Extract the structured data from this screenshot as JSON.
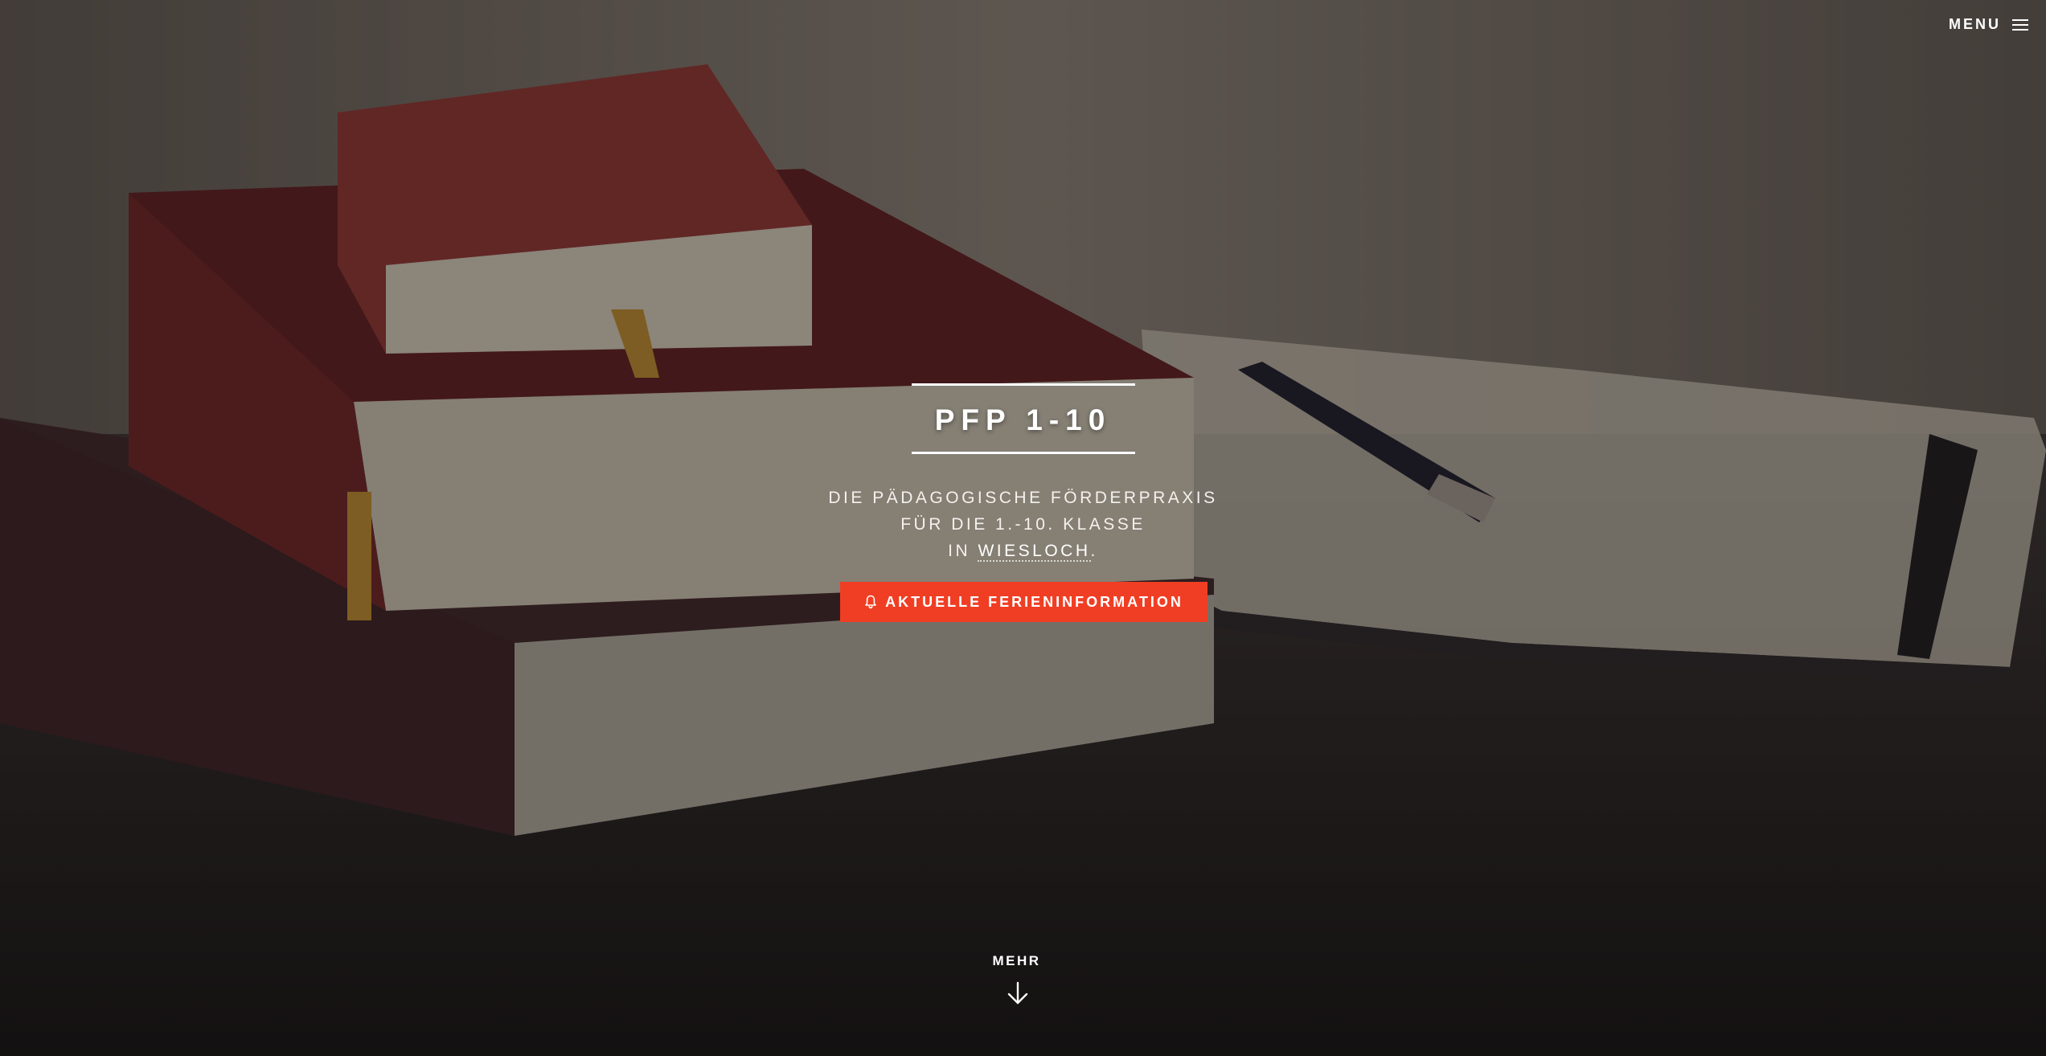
{
  "header": {
    "menu_label": "MENU",
    "menu_icon": "hamburger-icon"
  },
  "hero": {
    "title": "PFP 1-10",
    "subtitle_line1": "DIE PÄDAGOGISCHE FÖRDERPRAXIS",
    "subtitle_line2": "FÜR DIE 1.-10. KLASSE",
    "subtitle_line3_prefix": "IN ",
    "subtitle_line3_link": "WIESLOCH",
    "subtitle_line3_suffix": ".",
    "cta_label": "AKTUELLE FERIENINFORMATION",
    "cta_icon": "bell-icon",
    "more_label": "MEHR",
    "more_icon": "arrow-down-icon"
  },
  "colors": {
    "accent": "#f03e24",
    "text": "#ffffff"
  }
}
